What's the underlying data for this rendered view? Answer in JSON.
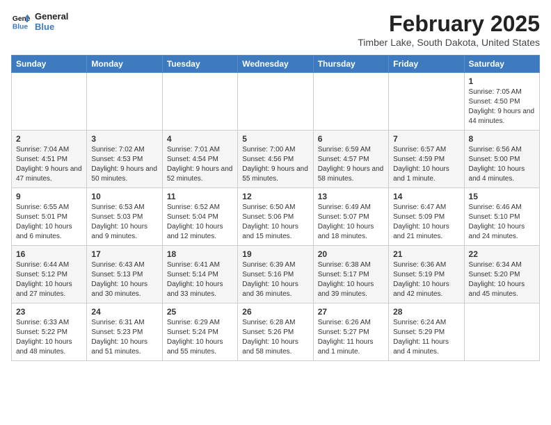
{
  "header": {
    "logo_line1": "General",
    "logo_line2": "Blue",
    "month_title": "February 2025",
    "location": "Timber Lake, South Dakota, United States"
  },
  "weekdays": [
    "Sunday",
    "Monday",
    "Tuesday",
    "Wednesday",
    "Thursday",
    "Friday",
    "Saturday"
  ],
  "weeks": [
    [
      {
        "day": "",
        "info": ""
      },
      {
        "day": "",
        "info": ""
      },
      {
        "day": "",
        "info": ""
      },
      {
        "day": "",
        "info": ""
      },
      {
        "day": "",
        "info": ""
      },
      {
        "day": "",
        "info": ""
      },
      {
        "day": "1",
        "info": "Sunrise: 7:05 AM\nSunset: 4:50 PM\nDaylight: 9 hours and 44 minutes."
      }
    ],
    [
      {
        "day": "2",
        "info": "Sunrise: 7:04 AM\nSunset: 4:51 PM\nDaylight: 9 hours and 47 minutes."
      },
      {
        "day": "3",
        "info": "Sunrise: 7:02 AM\nSunset: 4:53 PM\nDaylight: 9 hours and 50 minutes."
      },
      {
        "day": "4",
        "info": "Sunrise: 7:01 AM\nSunset: 4:54 PM\nDaylight: 9 hours and 52 minutes."
      },
      {
        "day": "5",
        "info": "Sunrise: 7:00 AM\nSunset: 4:56 PM\nDaylight: 9 hours and 55 minutes."
      },
      {
        "day": "6",
        "info": "Sunrise: 6:59 AM\nSunset: 4:57 PM\nDaylight: 9 hours and 58 minutes."
      },
      {
        "day": "7",
        "info": "Sunrise: 6:57 AM\nSunset: 4:59 PM\nDaylight: 10 hours and 1 minute."
      },
      {
        "day": "8",
        "info": "Sunrise: 6:56 AM\nSunset: 5:00 PM\nDaylight: 10 hours and 4 minutes."
      }
    ],
    [
      {
        "day": "9",
        "info": "Sunrise: 6:55 AM\nSunset: 5:01 PM\nDaylight: 10 hours and 6 minutes."
      },
      {
        "day": "10",
        "info": "Sunrise: 6:53 AM\nSunset: 5:03 PM\nDaylight: 10 hours and 9 minutes."
      },
      {
        "day": "11",
        "info": "Sunrise: 6:52 AM\nSunset: 5:04 PM\nDaylight: 10 hours and 12 minutes."
      },
      {
        "day": "12",
        "info": "Sunrise: 6:50 AM\nSunset: 5:06 PM\nDaylight: 10 hours and 15 minutes."
      },
      {
        "day": "13",
        "info": "Sunrise: 6:49 AM\nSunset: 5:07 PM\nDaylight: 10 hours and 18 minutes."
      },
      {
        "day": "14",
        "info": "Sunrise: 6:47 AM\nSunset: 5:09 PM\nDaylight: 10 hours and 21 minutes."
      },
      {
        "day": "15",
        "info": "Sunrise: 6:46 AM\nSunset: 5:10 PM\nDaylight: 10 hours and 24 minutes."
      }
    ],
    [
      {
        "day": "16",
        "info": "Sunrise: 6:44 AM\nSunset: 5:12 PM\nDaylight: 10 hours and 27 minutes."
      },
      {
        "day": "17",
        "info": "Sunrise: 6:43 AM\nSunset: 5:13 PM\nDaylight: 10 hours and 30 minutes."
      },
      {
        "day": "18",
        "info": "Sunrise: 6:41 AM\nSunset: 5:14 PM\nDaylight: 10 hours and 33 minutes."
      },
      {
        "day": "19",
        "info": "Sunrise: 6:39 AM\nSunset: 5:16 PM\nDaylight: 10 hours and 36 minutes."
      },
      {
        "day": "20",
        "info": "Sunrise: 6:38 AM\nSunset: 5:17 PM\nDaylight: 10 hours and 39 minutes."
      },
      {
        "day": "21",
        "info": "Sunrise: 6:36 AM\nSunset: 5:19 PM\nDaylight: 10 hours and 42 minutes."
      },
      {
        "day": "22",
        "info": "Sunrise: 6:34 AM\nSunset: 5:20 PM\nDaylight: 10 hours and 45 minutes."
      }
    ],
    [
      {
        "day": "23",
        "info": "Sunrise: 6:33 AM\nSunset: 5:22 PM\nDaylight: 10 hours and 48 minutes."
      },
      {
        "day": "24",
        "info": "Sunrise: 6:31 AM\nSunset: 5:23 PM\nDaylight: 10 hours and 51 minutes."
      },
      {
        "day": "25",
        "info": "Sunrise: 6:29 AM\nSunset: 5:24 PM\nDaylight: 10 hours and 55 minutes."
      },
      {
        "day": "26",
        "info": "Sunrise: 6:28 AM\nSunset: 5:26 PM\nDaylight: 10 hours and 58 minutes."
      },
      {
        "day": "27",
        "info": "Sunrise: 6:26 AM\nSunset: 5:27 PM\nDaylight: 11 hours and 1 minute."
      },
      {
        "day": "28",
        "info": "Sunrise: 6:24 AM\nSunset: 5:29 PM\nDaylight: 11 hours and 4 minutes."
      },
      {
        "day": "",
        "info": ""
      }
    ]
  ]
}
